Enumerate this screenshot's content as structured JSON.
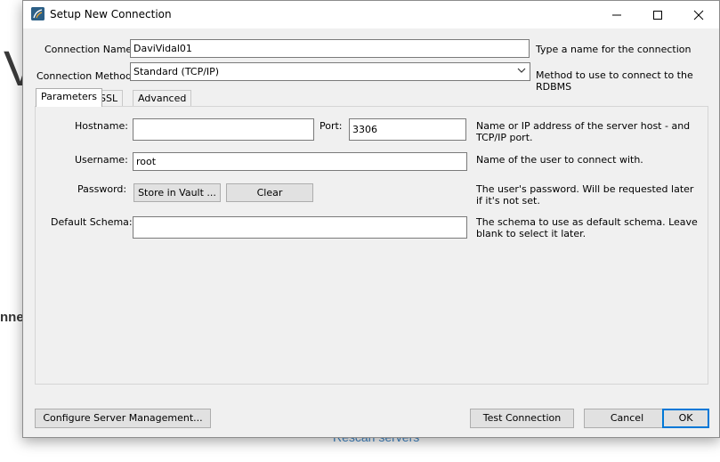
{
  "background": {
    "heading_fragment": "V",
    "side_fragment": "nne",
    "rescan_link": "Rescan servers"
  },
  "window": {
    "title": "Setup New Connection",
    "icon": "mysql-workbench-icon",
    "minimize_icon": "minimize-icon",
    "maximize_icon": "maximize-icon",
    "close_icon": "close-icon"
  },
  "connection": {
    "name_label": "Connection Name:",
    "name_value": "DaviVidal01",
    "name_hint": "Type a name for the connection",
    "method_label": "Connection Method:",
    "method_value": "Standard (TCP/IP)",
    "method_hint": "Method to use to connect to the RDBMS"
  },
  "tabs": [
    {
      "label": "Parameters",
      "active": true
    },
    {
      "label": "SSL",
      "active": false
    },
    {
      "label": "Advanced",
      "active": false
    }
  ],
  "parameters": {
    "hostname_label": "Hostname:",
    "hostname_value": "",
    "port_label": "Port:",
    "port_value": "3306",
    "host_hint": "Name or IP address of the server host - and TCP/IP port.",
    "username_label": "Username:",
    "username_value": "root",
    "username_hint": "Name of the user to connect with.",
    "password_label": "Password:",
    "store_vault_label": "Store in Vault ...",
    "clear_label": "Clear",
    "password_hint": "The user's password. Will be requested later if it's not set.",
    "schema_label": "Default Schema:",
    "schema_value": "",
    "schema_hint": "The schema to use as default schema. Leave blank to select it later."
  },
  "footer": {
    "configure_label": "Configure Server Management...",
    "test_label": "Test Connection",
    "cancel_label": "Cancel",
    "ok_label": "OK"
  },
  "colors": {
    "dialog_bg": "#f0f0f0",
    "accent": "#0078d7",
    "link": "#3f86c6"
  }
}
